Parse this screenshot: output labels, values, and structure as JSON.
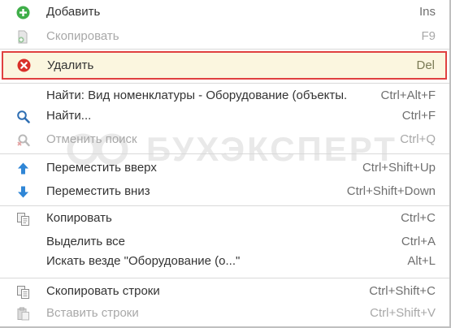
{
  "watermark": {
    "text": "БУХЭКСПЕРТ"
  },
  "menu": {
    "items": [
      {
        "label": "Добавить",
        "shortcut": "Ins",
        "icon": "add-icon"
      },
      {
        "label": "Скопировать",
        "shortcut": "F9",
        "icon": "copy-doc-icon"
      },
      {
        "label": "Удалить",
        "shortcut": "Del",
        "icon": "delete-icon"
      },
      {
        "label": "Найти: Вид номенклатуры - Оборудование (объекты...",
        "shortcut": "Ctrl+Alt+F",
        "icon": ""
      },
      {
        "label": "Найти...",
        "shortcut": "Ctrl+F",
        "icon": "search-icon"
      },
      {
        "label": "Отменить поиск",
        "shortcut": "Ctrl+Q",
        "icon": "cancel-search-icon"
      },
      {
        "label": "Переместить вверх",
        "shortcut": "Ctrl+Shift+Up",
        "icon": "arrow-up-icon"
      },
      {
        "label": "Переместить вниз",
        "shortcut": "Ctrl+Shift+Down",
        "icon": "arrow-down-icon"
      },
      {
        "label": "Копировать",
        "shortcut": "Ctrl+C",
        "icon": "copy-icon"
      },
      {
        "label": "Выделить все",
        "shortcut": "Ctrl+A",
        "icon": ""
      },
      {
        "label": "Искать везде \"Оборудование (о...\"",
        "shortcut": "Alt+L",
        "icon": ""
      },
      {
        "label": "Скопировать строки",
        "shortcut": "Ctrl+Shift+C",
        "icon": "copy-rows-icon"
      },
      {
        "label": "Вставить строки",
        "shortcut": "Ctrl+Shift+V",
        "icon": "paste-rows-icon"
      }
    ]
  },
  "colors": {
    "highlight_border": "#e04040",
    "highlight_bg": "#fbf6df",
    "add_green": "#3fae49",
    "delete_red": "#d9302a",
    "arrow_blue": "#2f86d6",
    "disabled_text": "#a8a8a8"
  }
}
